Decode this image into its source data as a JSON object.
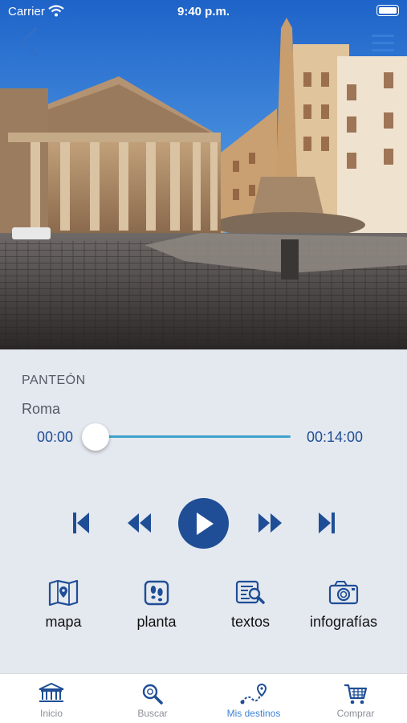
{
  "status_bar": {
    "carrier": "Carrier",
    "time": "9:40 p.m."
  },
  "header": {
    "back_icon": "chevron-left-icon",
    "menu_icon": "hamburger-icon"
  },
  "hero": {
    "image_label": "Pantheon photo"
  },
  "monument": {
    "name": "PANTEÓN",
    "city": "Roma"
  },
  "player": {
    "current_time": "00:00",
    "total_time": "00:14:00",
    "progress": 0,
    "accent_color": "#1f4e96",
    "track_color": "#3fa3c9"
  },
  "controls": {
    "previous": "skip-back-icon",
    "rewind": "rewind-icon",
    "play": "play-icon",
    "forward": "fast-forward-icon",
    "next": "skip-forward-icon"
  },
  "tools": [
    {
      "label": "mapa",
      "icon": "map-icon"
    },
    {
      "label": "planta",
      "icon": "floor-plan-icon"
    },
    {
      "label": "textos",
      "icon": "text-search-icon"
    },
    {
      "label": "infografías",
      "icon": "camera-icon"
    }
  ],
  "tabbar": {
    "active_color": "#3b82d8",
    "items": [
      {
        "label": "Inicio",
        "icon": "temple-icon"
      },
      {
        "label": "Buscar",
        "icon": "search-icon"
      },
      {
        "label": "Mis destinos",
        "icon": "route-icon",
        "active": true
      },
      {
        "label": "Comprar",
        "icon": "cart-icon"
      }
    ]
  }
}
